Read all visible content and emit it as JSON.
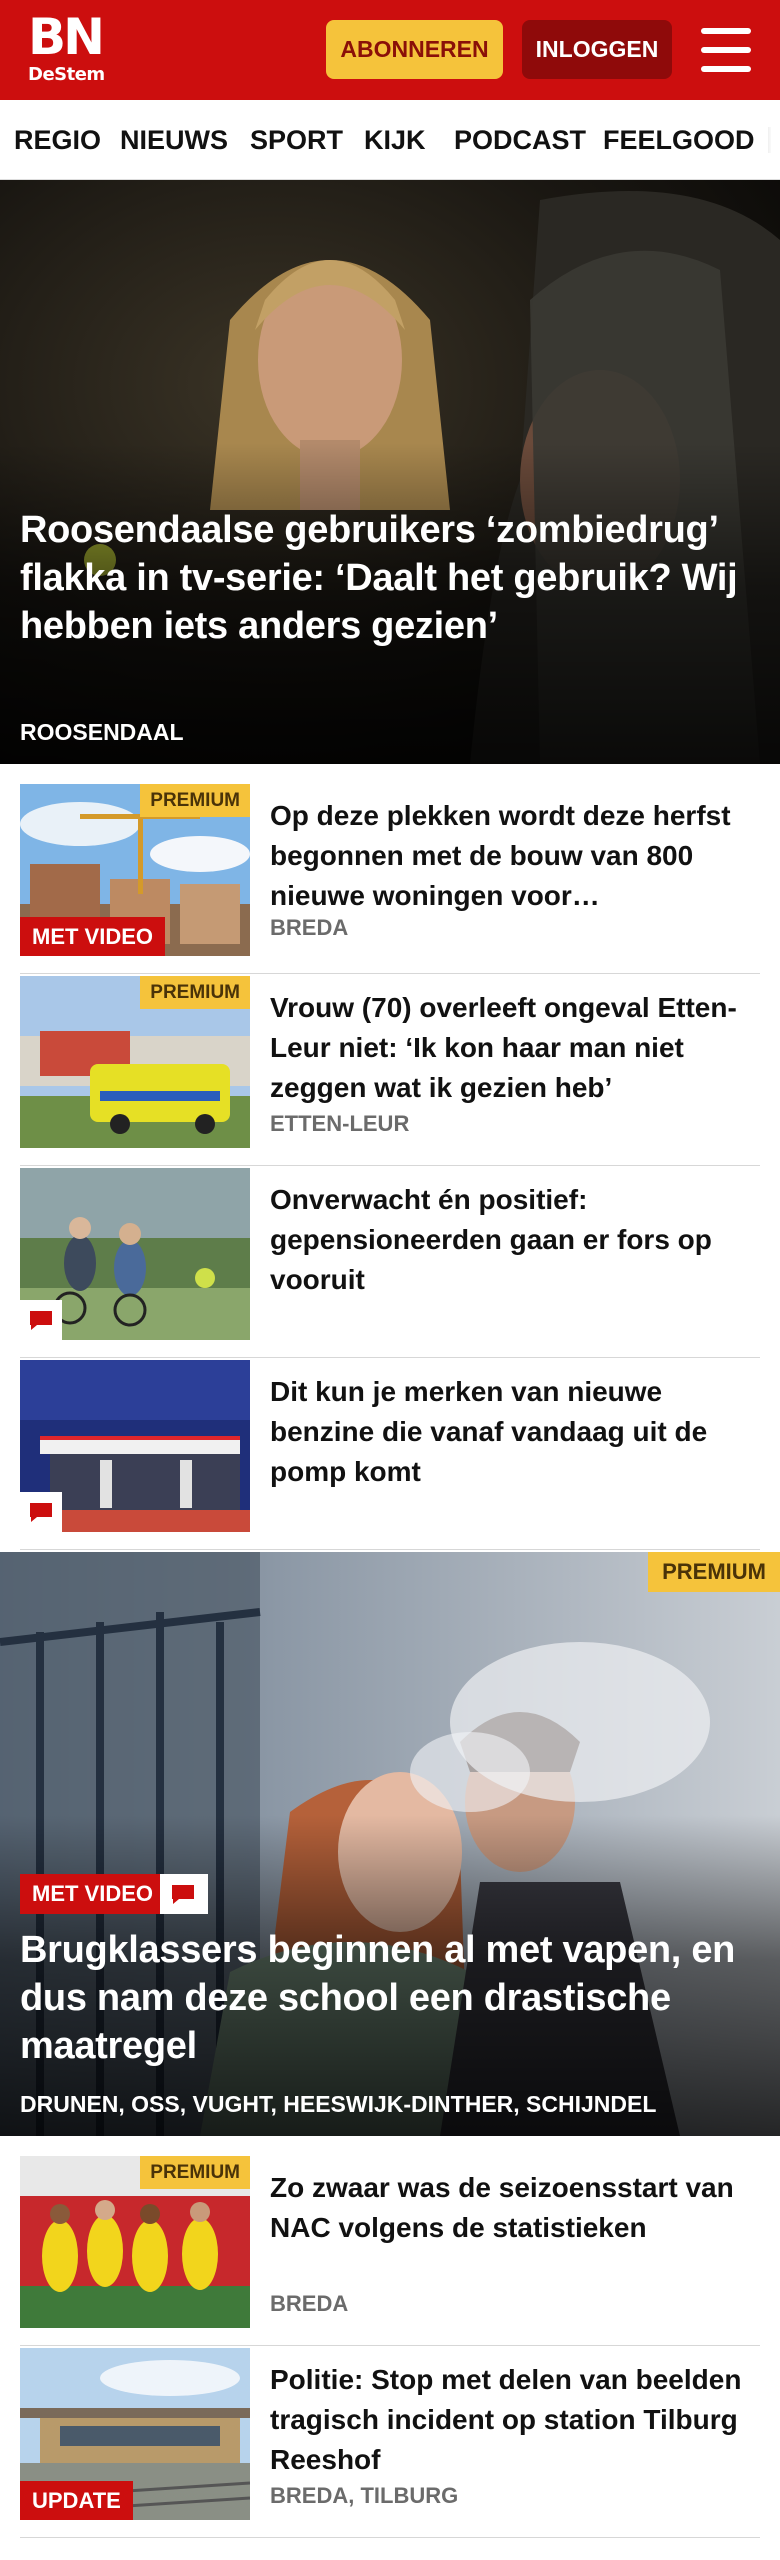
{
  "header": {
    "logo_main": "BN",
    "logo_sub": "DeStem",
    "subscribe_label": "ABONNEREN",
    "login_label": "INLOGGEN",
    "brand_color": "#cc0e0e"
  },
  "nav": {
    "items": [
      "REGIO",
      "NIEUWS",
      "SPORT",
      "KIJK",
      "PODCAST",
      "FEELGOOD"
    ]
  },
  "hero": {
    "title": "Roosendaalse gebruikers ‘zombiedrug’ flakka in tv-serie: ‘Daalt het gebruik? Wij hebben iets anders gezien’",
    "location": "ROOSENDAAL"
  },
  "articles": [
    {
      "title": "Op deze plekken wordt deze herfst begonnen met de bouw van 800 nieuwe woningen voor…",
      "location": "BREDA",
      "premium": "PREMIUM",
      "video": "MET VIDEO",
      "thumb_icon": "construction-image"
    },
    {
      "title": "Vrouw (70) overleeft ongeval Etten-Leur niet: ‘Ik kon haar man niet zeggen wat ik gezien heb’",
      "location": "ETTEN-LEUR",
      "premium": "PREMIUM",
      "thumb_icon": "ambulance-image"
    },
    {
      "title": "Onverwacht én positief: gepensioneerden gaan er fors op vooruit",
      "location": "",
      "comment_icon": "comment-icon",
      "thumb_icon": "cyclists-image"
    },
    {
      "title": "Dit kun je merken van nieuwe benzine die vanaf vandaag uit de pomp komt",
      "location": "",
      "comment_icon": "comment-icon",
      "thumb_icon": "gas-station-image"
    }
  ],
  "hero2": {
    "premium": "PREMIUM",
    "video": "MET VIDEO",
    "title": "Brugklassers beginnen al met vapen, en dus nam deze school een drastische maatregel",
    "location": "DRUNEN, OSS, VUGHT, HEESWIJK-DINTHER, SCHIJNDEL"
  },
  "articles2": [
    {
      "title": "Zo zwaar was de seizoensstart van NAC volgens de statistieken",
      "location": "BREDA",
      "premium": "PREMIUM",
      "thumb_icon": "football-team-image"
    },
    {
      "title": "Politie: Stop met delen van beelden tragisch incident op station Tilburg Reeshof",
      "location": "BREDA, TILBURG",
      "update": "UPDATE",
      "thumb_icon": "station-image"
    }
  ]
}
